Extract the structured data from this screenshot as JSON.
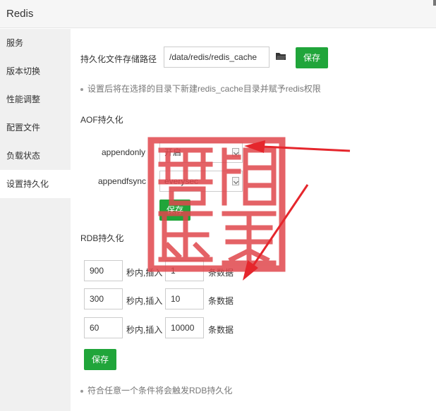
{
  "window": {
    "title": "Redis"
  },
  "sidebar": {
    "items": [
      {
        "label": "服务"
      },
      {
        "label": "版本切换"
      },
      {
        "label": "性能调整"
      },
      {
        "label": "配置文件"
      },
      {
        "label": "负载状态"
      },
      {
        "label": "设置持久化"
      }
    ],
    "active_index": 5
  },
  "path_section": {
    "label": "持久化文件存储路径",
    "value": "/data/redis/redis_cache",
    "save_label": "保存",
    "tip": "设置后将在选择的目录下新建redis_cache目录并赋予redis权限"
  },
  "aof": {
    "heading": "AOF持久化",
    "appendonly_label": "appendonly",
    "appendonly_value": "开启",
    "appendfsync_label": "appendfsync",
    "appendfsync_value": "everysec",
    "save_label": "保存"
  },
  "rdb": {
    "heading": "RDB持久化",
    "rows": [
      {
        "seconds": "900",
        "mid_text": "秒内,插入",
        "count": "1",
        "end_text": "条数据"
      },
      {
        "seconds": "300",
        "mid_text": "秒内,插入",
        "count": "10",
        "end_text": "条数据"
      },
      {
        "seconds": "60",
        "mid_text": "秒内,插入",
        "count": "10000",
        "end_text": "条数据"
      }
    ],
    "save_label": "保存",
    "tip": "符合任意一个条件将会触发RDB持久化"
  },
  "colors": {
    "accent": "#20a53a",
    "stamp": "#e0474c",
    "arrow": "#e5262c",
    "sidebar_bg": "#f0f0f0"
  },
  "icons": [
    "folder-icon",
    "chevron-down-icon"
  ],
  "overlay": {
    "stamp_text": "谱鲸"
  }
}
